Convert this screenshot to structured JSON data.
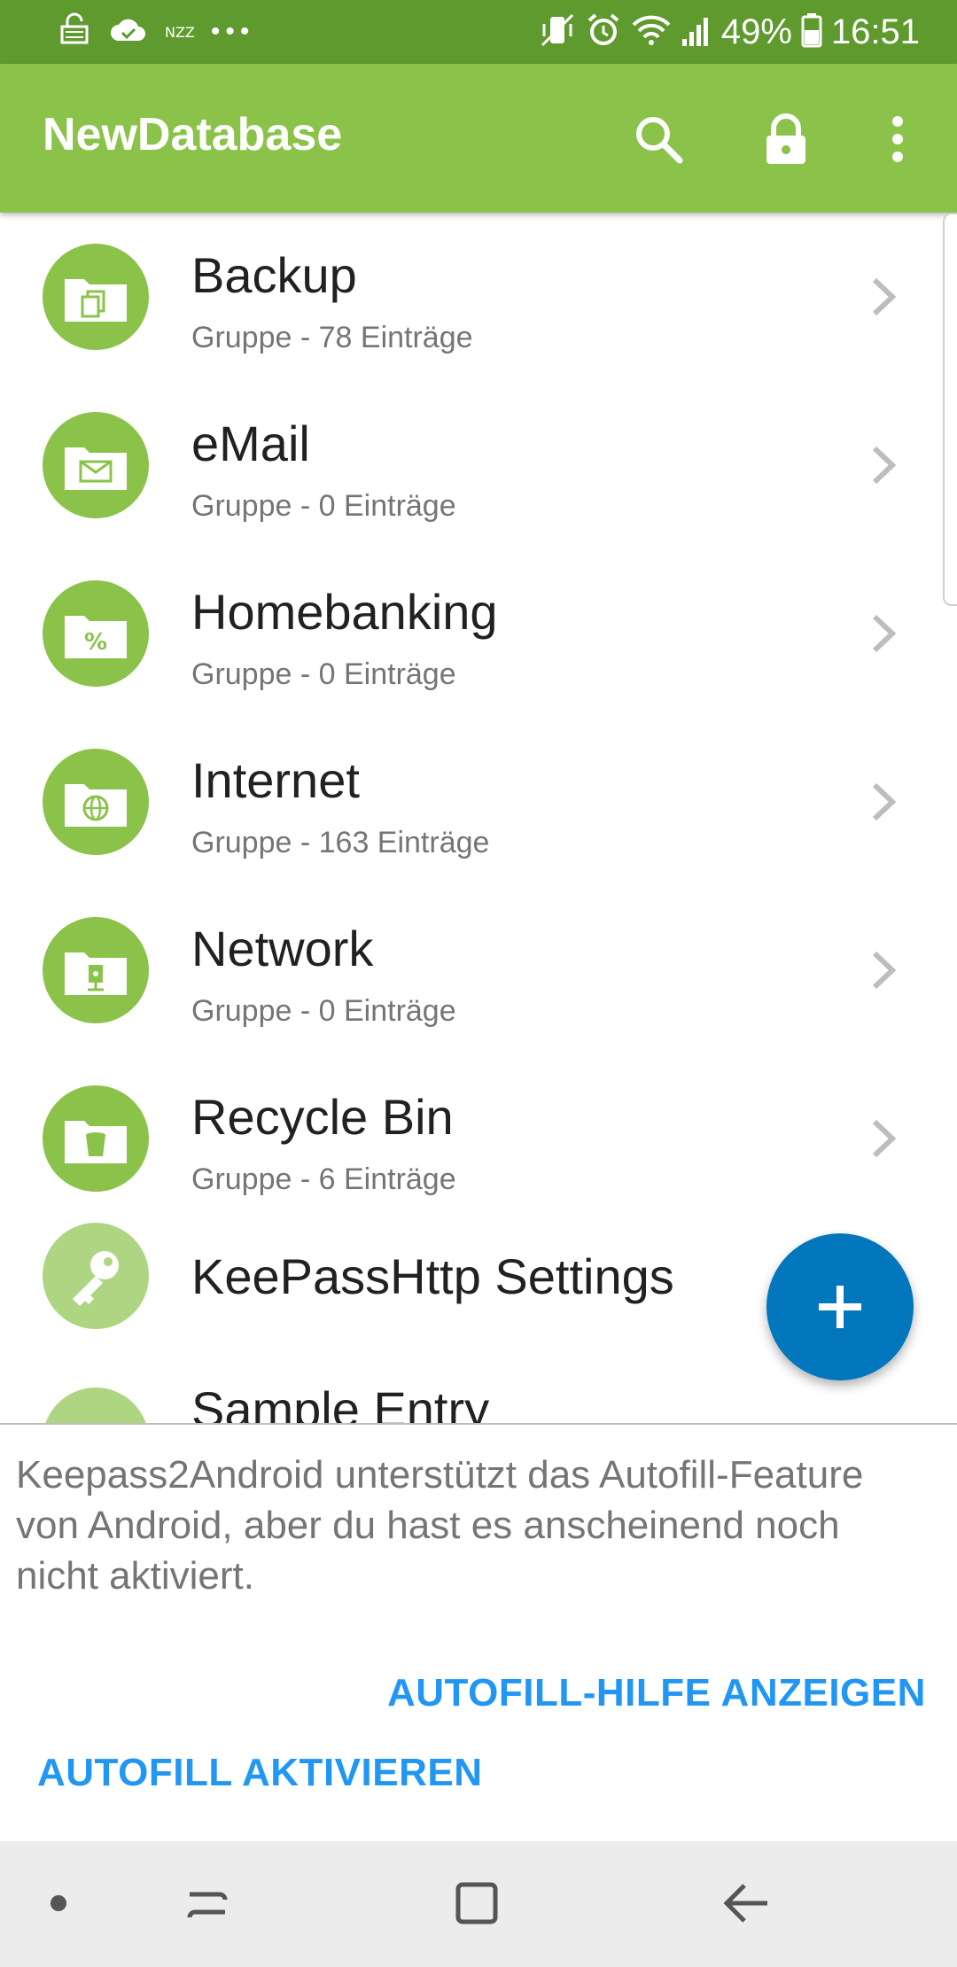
{
  "status_bar": {
    "carrier_badge": "NZZ",
    "more_dots": "•••",
    "battery_percent": "49%",
    "time": "16:51",
    "icons": [
      "vpn-key-icon",
      "cloud-done-icon",
      "vibrate-icon",
      "alarm-icon",
      "wifi-icon",
      "signal-icon",
      "battery-icon"
    ]
  },
  "app_bar": {
    "title": "NewDatabase",
    "actions": [
      "search-icon",
      "lock-icon",
      "overflow-menu-icon"
    ]
  },
  "list": {
    "items": [
      {
        "title": "Backup",
        "subtitle": "Gruppe - 78 Einträge",
        "icon": "backup-folder-icon"
      },
      {
        "title": "eMail",
        "subtitle": "Gruppe - 0 Einträge",
        "icon": "email-folder-icon"
      },
      {
        "title": "Homebanking",
        "subtitle": "Gruppe - 0 Einträge",
        "icon": "percent-folder-icon"
      },
      {
        "title": "Internet",
        "subtitle": "Gruppe - 163 Einträge",
        "icon": "globe-folder-icon"
      },
      {
        "title": "Network",
        "subtitle": "Gruppe - 0 Einträge",
        "icon": "network-folder-icon"
      },
      {
        "title": "Recycle Bin",
        "subtitle": "Gruppe - 6 Einträge",
        "icon": "trash-folder-icon"
      },
      {
        "title": "KeePassHttp Settings",
        "subtitle": "",
        "icon": "key-icon"
      },
      {
        "title": "Sample Entry",
        "subtitle": "",
        "icon": "entry-icon"
      }
    ]
  },
  "fab": {
    "icon": "plus-icon"
  },
  "autofill_panel": {
    "message": "Keepass2Android unterstützt das Autofill-Feature von Android, aber du hast es anscheinend noch nicht aktiviert.",
    "help_button": "AUTOFILL-HILFE ANZEIGEN",
    "activate_button": "AUTOFILL AKTIVIEREN"
  },
  "nav_bar": {
    "buttons": [
      "dot-icon",
      "recents-icon",
      "home-icon",
      "back-icon"
    ]
  },
  "colors": {
    "status_bar": "#5f9a2f",
    "app_bar": "#8bc34a",
    "fab": "#0277bd",
    "action_text": "#2196f3"
  }
}
